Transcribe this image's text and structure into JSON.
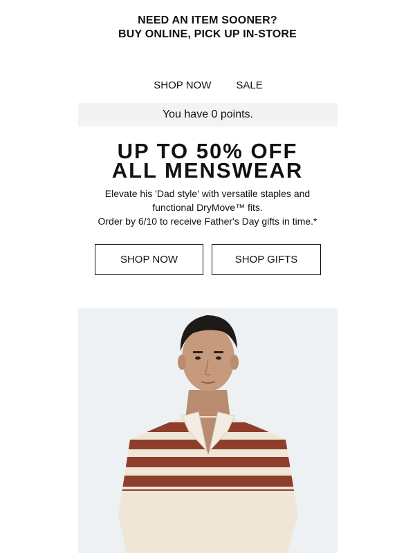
{
  "banner": {
    "line1": "NEED AN ITEM SOONER?",
    "line2": "BUY ONLINE, PICK UP IN-STORE"
  },
  "nav": {
    "items": [
      {
        "label": "SHOP NOW"
      },
      {
        "label": "SALE"
      }
    ]
  },
  "points": {
    "text": "You have 0 points."
  },
  "promo": {
    "headline_line1": "UP TO 50% OFF",
    "headline_line2": "ALL MENSWEAR",
    "desc_line1": "Elevate his 'Dad style' with versatile staples and",
    "desc_line2": "functional DryMove™ fits.",
    "desc_line3": "Order by 6/10 to receive Father's Day gifts in time.*"
  },
  "cta": {
    "shop_now": "SHOP NOW",
    "shop_gifts": "SHOP GIFTS"
  },
  "hero": {
    "image": "man-in-striped-knit-polo",
    "colors": {
      "background": "#eef1f3",
      "shirt": "#efe6d8",
      "stripe": "#8e3e2a",
      "skin": "#c79a7d",
      "hair": "#1d1a18"
    }
  }
}
